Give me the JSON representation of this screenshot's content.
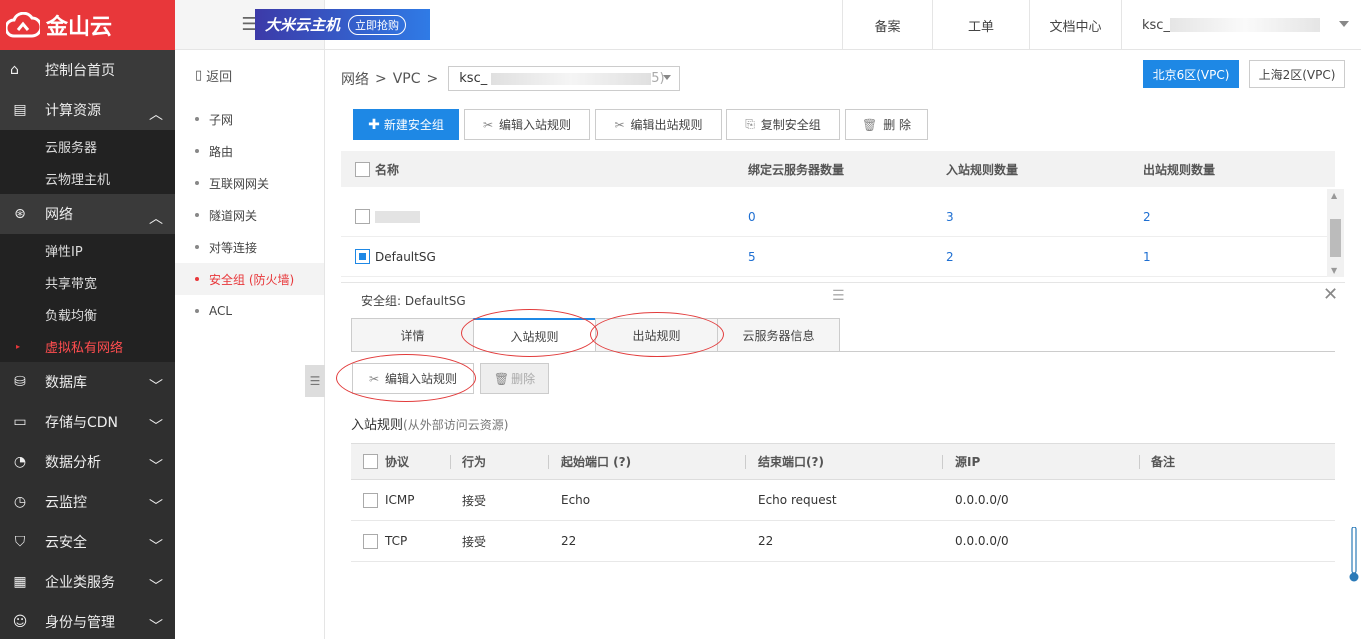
{
  "brand": {
    "name": "金山云",
    "color": "#e8373a"
  },
  "leftnav": {
    "home": "控制台首页",
    "compute": {
      "label": "计算资源",
      "items": [
        "云服务器",
        "云物理主机"
      ]
    },
    "network": {
      "label": "网络",
      "items": [
        "弹性IP",
        "共享带宽",
        "负载均衡",
        "虚拟私有网络"
      ]
    },
    "sections": [
      "数据库",
      "存储与CDN",
      "数据分析",
      "云监控",
      "云安全",
      "企业类服务",
      "身份与管理"
    ]
  },
  "subnav": {
    "back": "返回",
    "items": [
      "子网",
      "路由",
      "互联网网关",
      "隧道网关",
      "对等连接",
      "安全组 (防火墙)",
      "ACL"
    ]
  },
  "header": {
    "promo": "大米云主机",
    "promo_btn": "立即抢购",
    "record": "备案",
    "ticket": "工单",
    "docs": "文档中心",
    "account": "ksc_"
  },
  "breadcrumb": {
    "network": "网络",
    "vpc": "VPC",
    "sep": ">",
    "vpc_name": "ksc_",
    "vpc_suffix": "5)"
  },
  "regions": {
    "beijing": "北京6区(VPC)",
    "shanghai": "上海2区(VPC)"
  },
  "toolbar": {
    "new": "新建安全组",
    "edit_in": "编辑入站规则",
    "edit_out": "编辑出站规则",
    "copy": "复制安全组",
    "delete": "删 除"
  },
  "sg_table": {
    "headers": [
      "名称",
      "绑定云服务器数量",
      "入站规则数量",
      "出站规则数量"
    ],
    "rows": [
      {
        "name": "",
        "servers": "0",
        "inbound": "3",
        "outbound": "2"
      },
      {
        "name": "DefaultSG",
        "servers": "5",
        "inbound": "2",
        "outbound": "1"
      }
    ]
  },
  "detail": {
    "title": "安全组: DefaultSG",
    "tabs": [
      "详情",
      "入站规则",
      "出站规则",
      "云服务器信息"
    ],
    "edit_btn": "编辑入站规则",
    "delete_btn": "删除",
    "section_title": "入站规则",
    "section_sub": "(从外部访问云资源)",
    "headers": [
      "协议",
      "行为",
      "起始端口 (?)",
      "结束端口(?)",
      "源IP",
      "备注"
    ],
    "rows": [
      {
        "protocol": "ICMP",
        "action": "接受",
        "start": "Echo",
        "end": "Echo request",
        "source": "0.0.0.0/0",
        "note": ""
      },
      {
        "protocol": "TCP",
        "action": "接受",
        "start": "22",
        "end": "22",
        "source": "0.0.0.0/0",
        "note": ""
      }
    ]
  }
}
